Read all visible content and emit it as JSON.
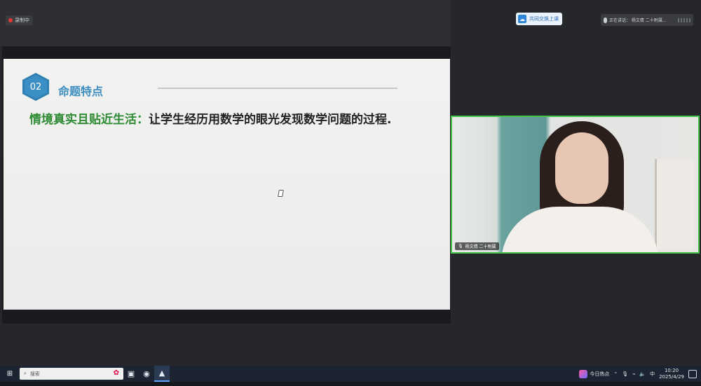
{
  "recording": {
    "label": "录制中"
  },
  "slide": {
    "badge_number": "02",
    "section_title": "命题特点",
    "highlight_text": "情境真实且贴近生活：",
    "body_text": "让学生经历用数学的眼光发现数学问题的过程."
  },
  "share_pill": {
    "icon": "cloud-share-icon",
    "label": "共同交换上课"
  },
  "speaker": {
    "label": "正在讲话：  杨文倩 二十附属...",
    "icon": "mic-icon"
  },
  "video": {
    "name_label": "杨文倩 二十附属"
  },
  "taskbar": {
    "search_placeholder": "搜索",
    "hot_label": "今日热点",
    "time": "10:20",
    "date": "2025/4/29",
    "ime": "中"
  },
  "colors": {
    "accent_blue": "#3e8fc1",
    "highlight_green": "#2e8b34",
    "speaking_border": "#45c24a",
    "taskbar": "#1b2430"
  }
}
